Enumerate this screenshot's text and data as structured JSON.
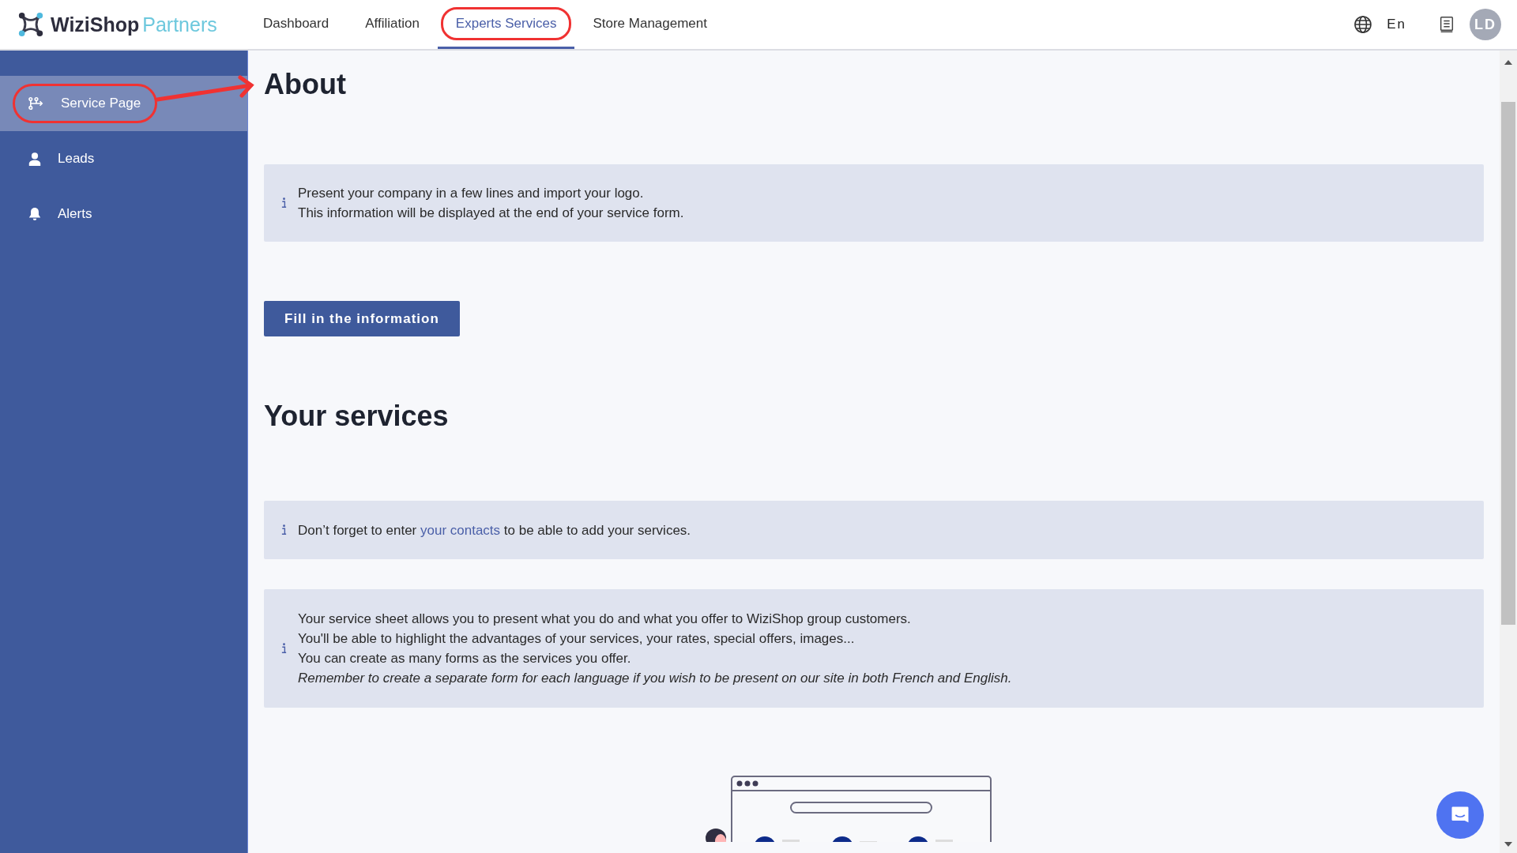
{
  "logo": {
    "brand": "WiziShop",
    "suffix": "Partners"
  },
  "nav": [
    {
      "label": "Dashboard",
      "selected": false,
      "circled": false
    },
    {
      "label": "Affiliation",
      "selected": false,
      "circled": false
    },
    {
      "label": "Experts Services",
      "selected": true,
      "circled": true
    },
    {
      "label": "Store Management",
      "selected": false,
      "circled": false
    }
  ],
  "language": "En",
  "avatar": "LD",
  "sidebar": {
    "items": [
      {
        "label": "Service Page",
        "kind": "service",
        "selected": true,
        "circled": true
      },
      {
        "label": "Leads",
        "kind": "leads",
        "selected": false,
        "circled": false
      },
      {
        "label": "Alerts",
        "kind": "alerts",
        "selected": false,
        "circled": false
      }
    ]
  },
  "about": {
    "heading": "About",
    "info_lines": [
      "Present your company in a few lines and import your logo.",
      "This information will be displayed at the end of your service form."
    ],
    "button": "Fill in the information"
  },
  "services": {
    "heading": "Your services",
    "notes": [
      {
        "lines": [
          {
            "parts": [
              {
                "kind": "text",
                "text": "Don’t forget to enter "
              },
              {
                "kind": "link",
                "text": "your contacts"
              },
              {
                "kind": "text",
                "text": " to be able to add your services."
              }
            ],
            "italic": false
          }
        ]
      },
      {
        "lines": [
          {
            "parts": [
              {
                "kind": "text",
                "text": "Your service sheet allows you to present what you do and what you offer to WiziShop group customers."
              }
            ],
            "italic": false
          },
          {
            "parts": [
              {
                "kind": "text",
                "text": "You'll be able to highlight the advantages of your services, your rates, special offers, images..."
              }
            ],
            "italic": false
          },
          {
            "parts": [
              {
                "kind": "text",
                "text": "You can create as many forms as the services you offer."
              }
            ],
            "italic": false
          },
          {
            "parts": [
              {
                "kind": "text",
                "text": "Remember to create a separate form for each language if you wish to be present on our site in both French and English."
              }
            ],
            "italic": true
          }
        ]
      }
    ]
  }
}
